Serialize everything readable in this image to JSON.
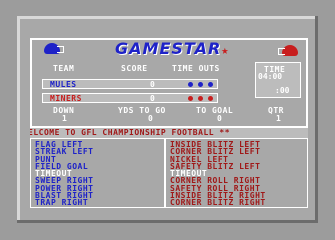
{
  "brand": {
    "name": "GAMESTAR",
    "star": "★"
  },
  "header": {
    "team": "TEAM",
    "score": "SCORE",
    "timeouts": "TIME OUTS",
    "time": "TIME"
  },
  "teams": [
    {
      "name": "MULES",
      "score": "0",
      "color": "#1e22c8"
    },
    {
      "name": "MINERS",
      "score": "0",
      "color": "#c81e1e"
    }
  ],
  "clock": {
    "game_time": "04:00",
    "play_clock": ":00"
  },
  "status": {
    "down_label": "DOWN",
    "down": "1",
    "yds_label": "YDS TO GO",
    "yds": "0",
    "goal_label": "TO GOAL",
    "goal": "0",
    "qtr_label": "QTR",
    "qtr": "1"
  },
  "banner": "ELCOME TO GFL CHAMPIONSHIP FOOTBALL **",
  "offense_plays": [
    "FLAG LEFT",
    "STREAK LEFT",
    "PUNT",
    "FIELD GOAL",
    "TIMEOUT",
    "SWEEP RIGHT",
    "POWER RIGHT",
    "BLAST RIGHT",
    "TRAP RIGHT"
  ],
  "defense_plays": [
    "INSIDE BLITZ LEFT",
    "CORNER BLITZ LEFT",
    "NICKEL LEFT",
    "SAFETY BLITZ LEFT",
    "TIMEOUT",
    "CORNER ROLL RIGHT",
    "SAFETY ROLL RIGHT",
    "INSIDE BLITZ RIGHT",
    "CORNER BLITZ RIGHT"
  ],
  "colors": {
    "blue": "#1e22c8",
    "red": "#c81e1e",
    "dark_red": "#a01818",
    "white": "#ffffff"
  }
}
